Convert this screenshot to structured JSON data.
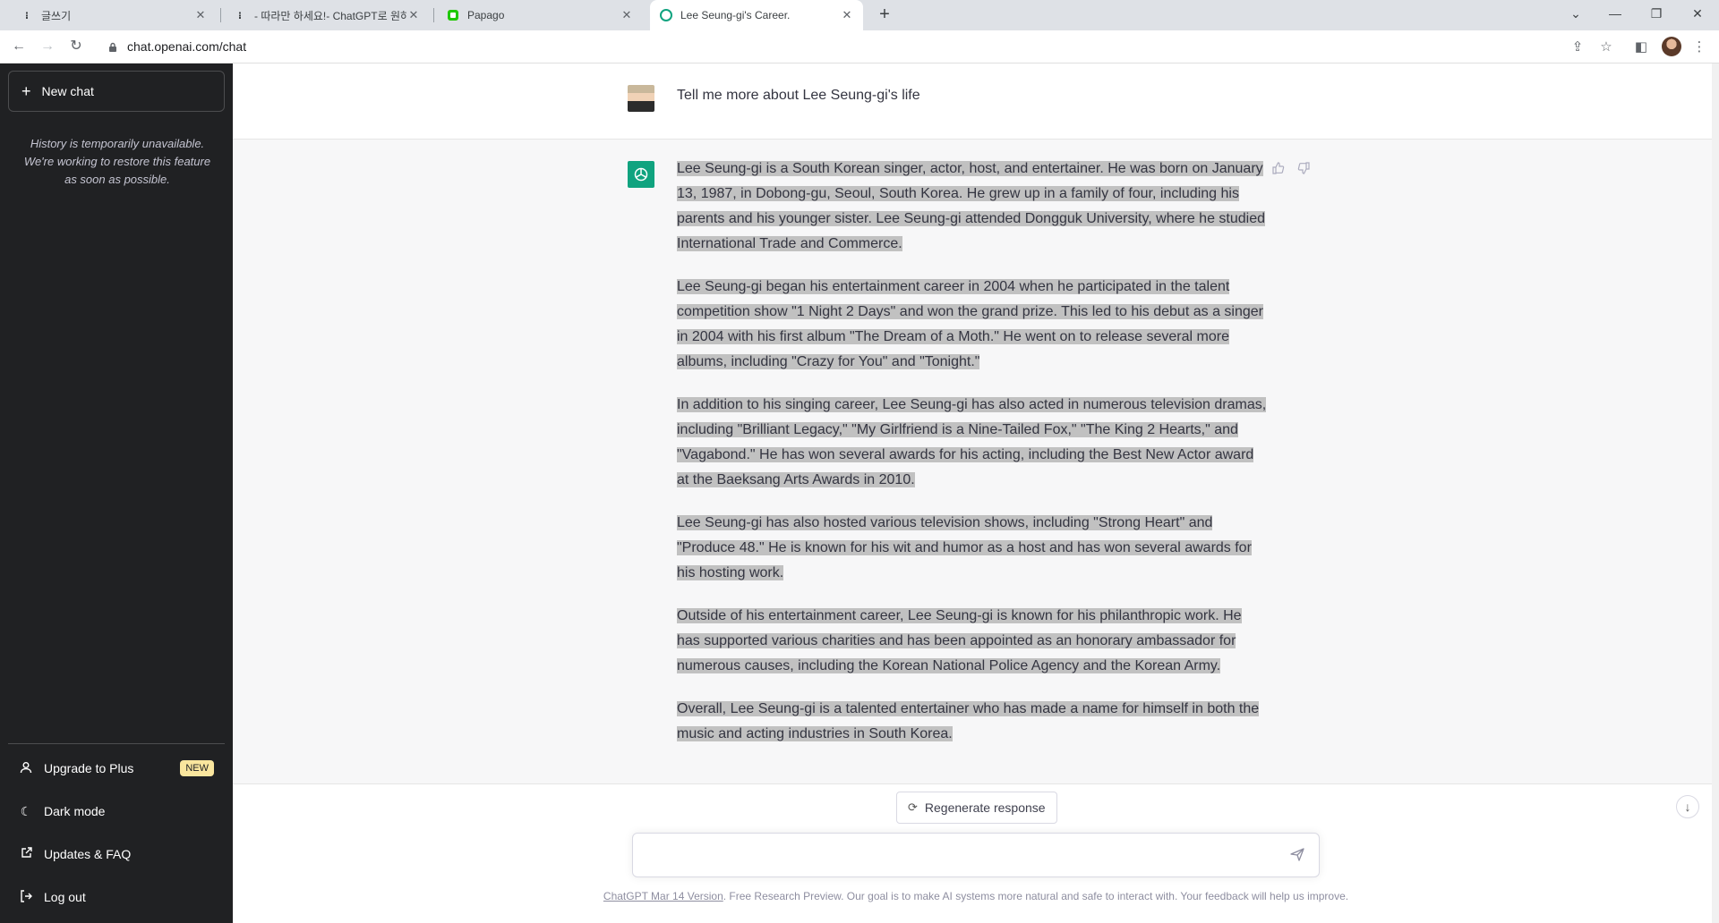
{
  "browser": {
    "tabs": [
      {
        "title": "글쓰기",
        "favicon": "tistory-icon"
      },
      {
        "title": "- 따라만 하세요!- ChatGPT로 원하는",
        "favicon": "tistory-icon"
      },
      {
        "title": "Papago",
        "favicon": "papago-icon"
      },
      {
        "title": "Lee Seung-gi's Career.",
        "favicon": "openai-icon",
        "active": true
      }
    ],
    "url": "chat.openai.com/chat"
  },
  "sidebar": {
    "new_chat": "New chat",
    "history_note": "History is temporarily unavailable. We're working to restore this feature as soon as possible.",
    "items": [
      {
        "label": "Upgrade to Plus",
        "icon": "user-icon",
        "badge": "NEW"
      },
      {
        "label": "Dark mode",
        "icon": "moon-icon"
      },
      {
        "label": "Updates & FAQ",
        "icon": "external-link-icon"
      },
      {
        "label": "Log out",
        "icon": "logout-icon"
      }
    ]
  },
  "conversation": {
    "user_message": "Tell me more about Lee Seung-gi's life",
    "assistant_paragraphs": [
      "Lee Seung-gi is a South Korean singer, actor, host, and entertainer. He was born on January 13, 1987, in Dobong-gu, Seoul, South Korea. He grew up in a family of four, including his parents and his younger sister. Lee Seung-gi attended Dongguk University, where he studied International Trade and Commerce.",
      "Lee Seung-gi began his entertainment career in 2004 when he participated in the talent competition show \"1 Night 2 Days\" and won the grand prize. This led to his debut as a singer in 2004 with his first album \"The Dream of a Moth.\" He went on to release several more albums, including \"Crazy for You\" and \"Tonight.\"",
      "In addition to his singing career, Lee Seung-gi has also acted in numerous television dramas, including \"Brilliant Legacy,\" \"My Girlfriend is a Nine-Tailed Fox,\" \"The King 2 Hearts,\" and \"Vagabond.\" He has won several awards for his acting, including the Best New Actor award at the Baeksang Arts Awards in 2010.",
      "Lee Seung-gi has also hosted various television shows, including \"Strong Heart\" and \"Produce 48.\" He is known for his wit and humor as a host and has won several awards for his hosting work.",
      "Outside of his entertainment career, Lee Seung-gi is known for his philanthropic work. He has supported various charities and has been appointed as an honorary ambassador for numerous causes, including the Korean National Police Agency and the Korean Army.",
      "Overall, Lee Seung-gi is a talented entertainer who has made a name for himself in both the music and acting industries in South Korea."
    ]
  },
  "composer": {
    "regenerate": "Regenerate response",
    "placeholder": ""
  },
  "footer": {
    "version_link": "ChatGPT Mar 14 Version",
    "text": ". Free Research Preview. Our goal is to make AI systems more natural and safe to interact with. Your feedback will help us improve."
  },
  "colors": {
    "sidebar_bg": "#202123",
    "accent": "#10a37f",
    "selection": "#c1c1c1"
  }
}
